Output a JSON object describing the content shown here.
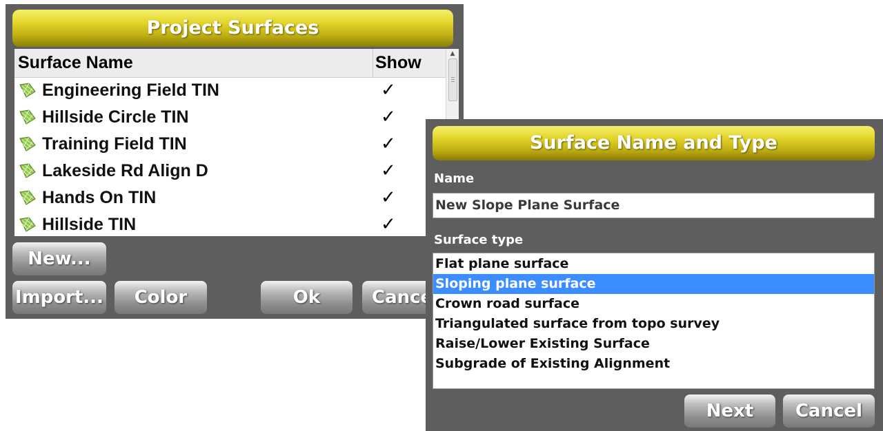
{
  "project_surfaces": {
    "title": "Project Surfaces",
    "columns": {
      "name": "Surface Name",
      "show": "Show"
    },
    "rows": [
      {
        "name": "Engineering Field TIN",
        "show": "✓"
      },
      {
        "name": "Hillside Circle TIN",
        "show": "✓"
      },
      {
        "name": "Training Field TIN",
        "show": "✓"
      },
      {
        "name": "Lakeside Rd Align D",
        "show": "✓"
      },
      {
        "name": "Hands On TIN",
        "show": "✓"
      },
      {
        "name": "Hillside TIN",
        "show": "✓"
      }
    ],
    "buttons": {
      "new": "New...",
      "import": "Import...",
      "color": "Color",
      "ok": "Ok",
      "cancel": "Cancel"
    }
  },
  "surface_dialog": {
    "title": "Surface Name and Type",
    "name_label": "Name",
    "name_value": "New Slope Plane Surface",
    "type_label": "Surface type",
    "types": [
      "Flat plane surface",
      "Sloping plane surface",
      "Crown road surface",
      "Triangulated surface from topo survey",
      "Raise/Lower Existing Surface",
      "Subgrade of Existing Alignment"
    ],
    "selected_type": "Sloping plane surface",
    "buttons": {
      "next": "Next",
      "cancel": "Cancel"
    }
  },
  "colors": {
    "panel_bg": "#5e5e5e",
    "title_gradient": "#e3d52c",
    "selection": "#3c8dff"
  },
  "icons": {
    "surface_row": "tin-surface-icon",
    "scroll_up": "scroll-up-arrow-icon"
  }
}
